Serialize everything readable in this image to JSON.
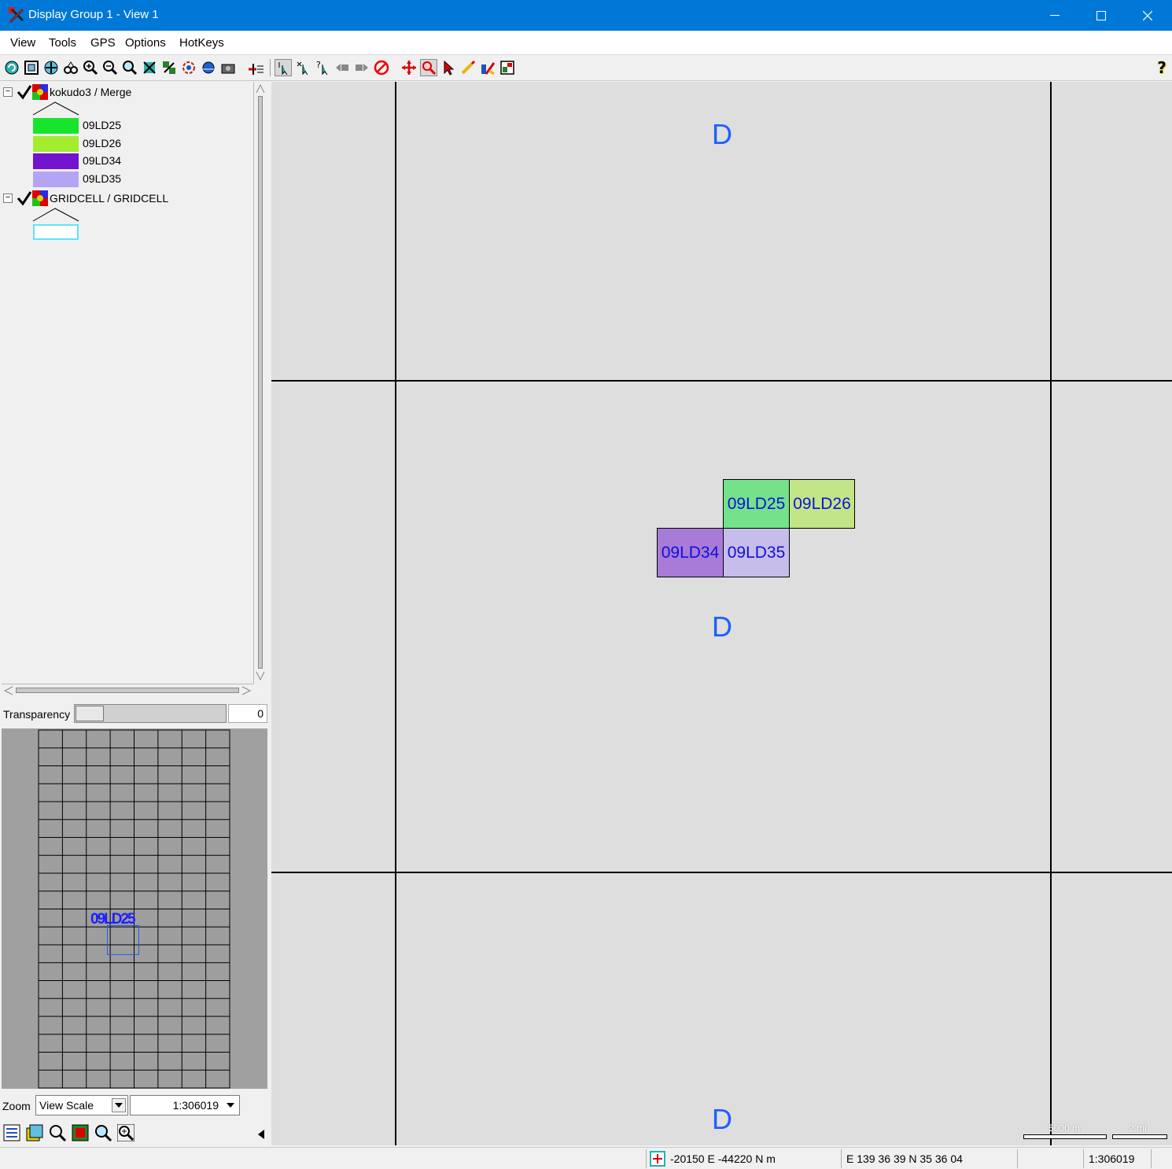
{
  "window": {
    "title": "Display Group 1 - View 1",
    "minimize_glyph": "—",
    "maximize_glyph": "☐",
    "close_glyph": "✕"
  },
  "menu": [
    "View",
    "Tools",
    "GPS",
    "Options",
    "HotKeys"
  ],
  "toolbar": {
    "help_glyph": "?"
  },
  "legend": {
    "layers": [
      {
        "name": "kokudo3 / Merge",
        "expander": "⊟",
        "items": [
          {
            "label": "09LD25",
            "color": "#17e52d"
          },
          {
            "label": "09LD26",
            "color": "#a4ec30"
          },
          {
            "label": "09LD34",
            "color": "#7213ce"
          },
          {
            "label": "09LD35",
            "color": "#b3a4f4"
          }
        ]
      },
      {
        "name": "GRIDCELL / GRIDCELL",
        "expander": "⊟",
        "items": [
          {
            "label": "",
            "color": "#5ee6f6"
          }
        ]
      }
    ]
  },
  "transparency": {
    "label": "Transparency",
    "value": "0",
    "slider_fraction": 0
  },
  "overview": {
    "label_text": "09LD25",
    "accent": "#1f1fff"
  },
  "zoom": {
    "label": "Zoom",
    "mode": "View Scale",
    "scale": "1:306019"
  },
  "map": {
    "d_label": "D",
    "cells": [
      {
        "label": "09LD25",
        "color": "#73e28a"
      },
      {
        "label": "09LD26",
        "color": "#c1e587"
      },
      {
        "label": "09LD34",
        "color": "#a87bd8"
      },
      {
        "label": "09LD35",
        "color": "#c6bdeb"
      }
    ],
    "scalebar": {
      "metric": "5000 m",
      "imperial": "2 mi"
    }
  },
  "status": {
    "projected": "-20150 E  -44220 N m",
    "geographic": "E 139 36 39  N 35 36 04",
    "blank": "",
    "scale": "1:306019"
  }
}
